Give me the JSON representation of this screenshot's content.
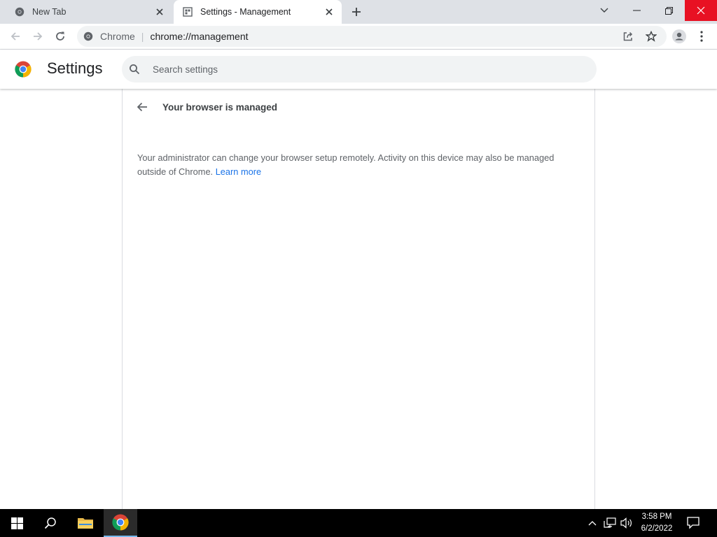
{
  "tabs": [
    {
      "title": "New Tab",
      "icon": "chrome-icon"
    },
    {
      "title": "Settings - Management",
      "icon": "settings-page-icon"
    }
  ],
  "omnibox": {
    "site_name": "Chrome",
    "url": "chrome://management"
  },
  "header": {
    "title": "Settings",
    "search_placeholder": "Search settings"
  },
  "management": {
    "title": "Your browser is managed",
    "description": "Your administrator can change your browser setup remotely. Activity on this device may also be managed outside of Chrome.",
    "learn_more": "Learn more"
  },
  "taskbar": {
    "time": "3:58 PM",
    "date": "6/2/2022"
  },
  "colors": {
    "accent": "#1a73e8",
    "tab_strip": "#dee1e6",
    "close_red": "#e81123"
  }
}
